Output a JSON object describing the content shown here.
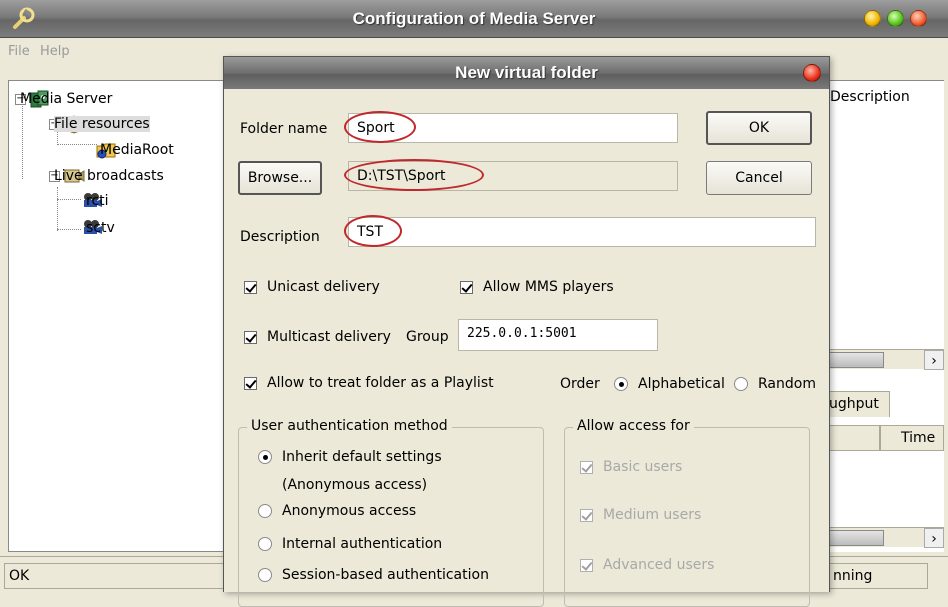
{
  "main": {
    "title": "Configuration of Media Server",
    "menu": [
      "File",
      "Help"
    ],
    "tree": {
      "root": "Media Server",
      "file_resources": "File resources",
      "media_root": "MediaRoot",
      "live_broadcasts": "Live broadcasts",
      "rcti": "rcti",
      "sctv": "sctv"
    },
    "right": {
      "description_header": "Description",
      "throughput_tab": "ughput",
      "time_header": "Time",
      "status_partial": "nning"
    },
    "status": "OK"
  },
  "dialog": {
    "title": "New virtual folder",
    "folder_name_label": "Folder name",
    "folder_name_value": "Sport",
    "browse_button": "Browse...",
    "path_value": "D:\\TST\\Sport",
    "ok_button": "OK",
    "cancel_button": "Cancel",
    "description_label": "Description",
    "description_value": "TST",
    "unicast_label": "Unicast delivery",
    "unicast_checked": true,
    "allow_mms_label": "Allow MMS players",
    "allow_mms_checked": true,
    "multicast_label": "Multicast delivery",
    "multicast_checked": true,
    "group_label": "Group",
    "group_value": "225.0.0.1:5001",
    "playlist_label": "Allow to treat folder as a Playlist",
    "playlist_checked": true,
    "order_label": "Order",
    "order_options": [
      "Alphabetical",
      "Random"
    ],
    "order_selected": "Alphabetical",
    "auth_group_title": "User authentication method",
    "auth_options": [
      "Inherit default settings",
      "(Anonymous access)",
      "Anonymous access",
      "Internal authentication",
      "Session-based authentication"
    ],
    "auth_selected": "Inherit default settings",
    "access_group_title": "Allow access for",
    "access_options": [
      "Basic users",
      "Medium users",
      "Advanced users"
    ]
  },
  "colors": {
    "highlight_ellipse": "#c0282c",
    "title_text": "#ffffff"
  }
}
